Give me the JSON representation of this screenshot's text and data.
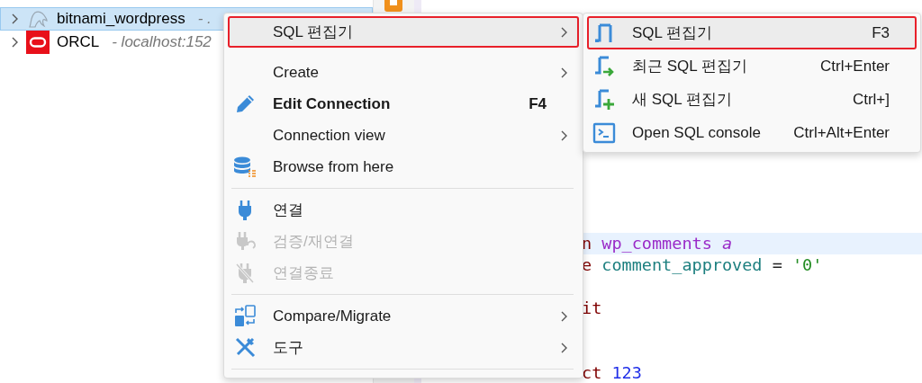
{
  "tree": {
    "items": [
      {
        "name": "bitnami_wordpress",
        "detail": "- .",
        "selected": true
      },
      {
        "name": "ORCL",
        "detail": "- localhost:152",
        "selected": false
      }
    ]
  },
  "editor": {
    "lines": [
      {
        "kind": "code",
        "current": true,
        "tokens": [
          {
            "kind": "keyword",
            "text": "n"
          },
          {
            "kind": "table",
            "text": "wp_comments"
          },
          {
            "kind": "alias",
            "text": "a"
          }
        ]
      },
      {
        "kind": "code",
        "current": false,
        "tokens": [
          {
            "kind": "keyword",
            "text": "e"
          },
          {
            "kind": "column",
            "text": "comment_approved"
          },
          {
            "kind": "operator",
            "text": "="
          },
          {
            "kind": "string",
            "text": "'0'"
          }
        ]
      },
      {
        "kind": "blank"
      },
      {
        "kind": "code",
        "current": false,
        "tokens": [
          {
            "kind": "keyword",
            "text": "it"
          }
        ]
      },
      {
        "kind": "blank"
      },
      {
        "kind": "blank"
      },
      {
        "kind": "code",
        "current": false,
        "tokens": [
          {
            "kind": "keyword",
            "text": "ct"
          },
          {
            "kind": "number",
            "text": "123"
          }
        ]
      }
    ]
  },
  "context_menu": {
    "items": [
      {
        "kind": "item",
        "label": "SQL 편집기",
        "submenu": true,
        "hovered": true,
        "outlined": true,
        "disabled": false,
        "default": false
      },
      {
        "kind": "item",
        "label": "Create",
        "submenu": true,
        "hovered": false,
        "outlined": false,
        "disabled": false,
        "default": false
      },
      {
        "kind": "item",
        "label": "Edit Connection",
        "shortcut": "F4",
        "submenu": false,
        "hovered": false,
        "outlined": false,
        "disabled": false,
        "default": true
      },
      {
        "kind": "item",
        "label": "Connection view",
        "submenu": true,
        "hovered": false,
        "outlined": false,
        "disabled": false,
        "default": false
      },
      {
        "kind": "item",
        "label": "Browse from here",
        "submenu": false,
        "hovered": false,
        "outlined": false,
        "disabled": false,
        "default": false
      },
      {
        "kind": "separator"
      },
      {
        "kind": "item",
        "label": "연결",
        "submenu": false,
        "hovered": false,
        "outlined": false,
        "disabled": false,
        "default": false
      },
      {
        "kind": "item",
        "label": "검증/재연결",
        "submenu": false,
        "hovered": false,
        "outlined": false,
        "disabled": true,
        "default": false
      },
      {
        "kind": "item",
        "label": "연결종료",
        "submenu": false,
        "hovered": false,
        "outlined": false,
        "disabled": true,
        "default": false
      },
      {
        "kind": "separator"
      },
      {
        "kind": "item",
        "label": "Compare/Migrate",
        "submenu": true,
        "hovered": false,
        "outlined": false,
        "disabled": false,
        "default": false
      },
      {
        "kind": "item",
        "label": "도구",
        "submenu": true,
        "hovered": false,
        "outlined": false,
        "disabled": false,
        "default": false
      },
      {
        "kind": "separator"
      }
    ]
  },
  "submenu": {
    "items": [
      {
        "kind": "item",
        "label": "SQL 편집기",
        "shortcut": "F3",
        "submenu": false,
        "hovered": true,
        "outlined": true,
        "disabled": false,
        "default": false
      },
      {
        "kind": "item",
        "label": "최근 SQL 편집기",
        "shortcut": "Ctrl+Enter",
        "submenu": false,
        "hovered": false,
        "outlined": false,
        "disabled": false,
        "default": false
      },
      {
        "kind": "item",
        "label": "새 SQL 편집기",
        "shortcut": "Ctrl+]",
        "submenu": false,
        "hovered": false,
        "outlined": false,
        "disabled": false,
        "default": false
      },
      {
        "kind": "item",
        "label": "Open SQL console",
        "shortcut": "Ctrl+Alt+Enter",
        "submenu": false,
        "hovered": false,
        "outlined": false,
        "disabled": false,
        "default": false
      }
    ]
  }
}
